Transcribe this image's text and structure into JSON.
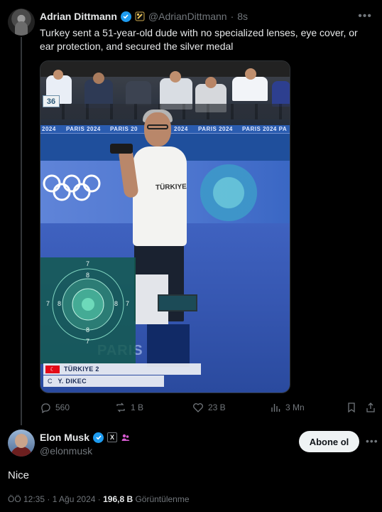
{
  "tweet1": {
    "name": "Adrian Dittmann",
    "handle": "@AdrianDittmann",
    "dot": "·",
    "time": "8s",
    "more": "•••",
    "text": "Turkey sent a 51-year-old dude with no specialized lenses, eye cover, or ear protection, and secured the silver medal",
    "media": {
      "lane_number": "36",
      "banner_text": "PARIS 2024",
      "shirt_text": "TÜRKIYE",
      "floor_text": "PARIS",
      "scoreboard_row1": "TÜRKIYE 2",
      "scoreboard_row2_prefix": "C",
      "scoreboard_row2": "Y. DIKEC",
      "target_numbers": [
        "7",
        "8",
        "7",
        "8",
        "8",
        "7",
        "8",
        "7"
      ]
    },
    "actions": {
      "replies": "560",
      "reposts": "1 B",
      "likes": "23 B",
      "views": "3 Mn"
    }
  },
  "tweet2": {
    "name": "Elon Musk",
    "x_badge": "X",
    "handle": "@elonmusk",
    "follow_label": "Abone ol",
    "more": "•••",
    "text": "Nice",
    "meta_time": "ÖÖ 12:35 · 1 Ağu 2024 · ",
    "meta_views": "196,8 B",
    "meta_views_label": " Görüntülenme"
  },
  "colors": {
    "background": "#000000",
    "text_primary": "#e7e9ea",
    "text_secondary": "#71767b",
    "verified_blue": "#1d9bf0",
    "follow_bg": "#eff3f4"
  },
  "icons": [
    "reply-icon",
    "repost-icon",
    "like-icon",
    "views-icon",
    "bookmark-icon",
    "share-icon",
    "verified-badge-icon",
    "gold-badge-icon",
    "x-badge-icon",
    "pink-badge-icon"
  ]
}
